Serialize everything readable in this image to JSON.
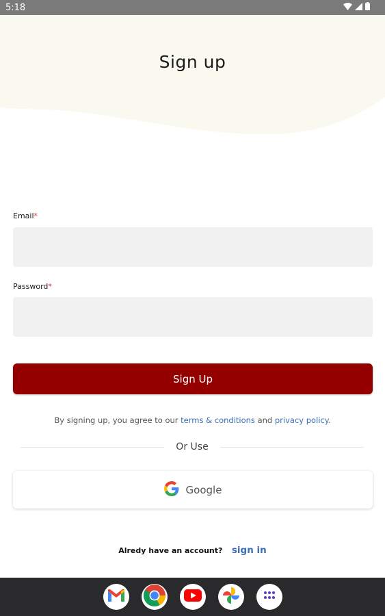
{
  "status_bar": {
    "time": "5:18",
    "icons": [
      "wifi-icon",
      "cellular-signal-icon",
      "battery-icon"
    ]
  },
  "header": {
    "title": "Sign up",
    "wave_color": "#f9f9ef"
  },
  "form": {
    "email": {
      "label": "Email",
      "required_mark": "*",
      "value": "",
      "placeholder": ""
    },
    "password": {
      "label": "Password",
      "required_mark": "*",
      "value": "",
      "placeholder": ""
    },
    "submit_label": "Sign Up",
    "submit_color": "#940000"
  },
  "terms": {
    "prefix": "By signing up, you agree to our ",
    "terms_link": "terms & conditions",
    "middle": " and ",
    "privacy_link": "privacy policy",
    "suffix": ".",
    "link_color": "#3d6fb6"
  },
  "divider": {
    "label": "Or Use"
  },
  "social": {
    "google_label": "Google",
    "icon": "google-icon"
  },
  "signin": {
    "question": "Alredy have an account?",
    "link": "sign in"
  },
  "dock": {
    "apps": [
      "gmail-icon",
      "chrome-icon",
      "youtube-icon",
      "photos-icon",
      "app-drawer-icon"
    ]
  }
}
